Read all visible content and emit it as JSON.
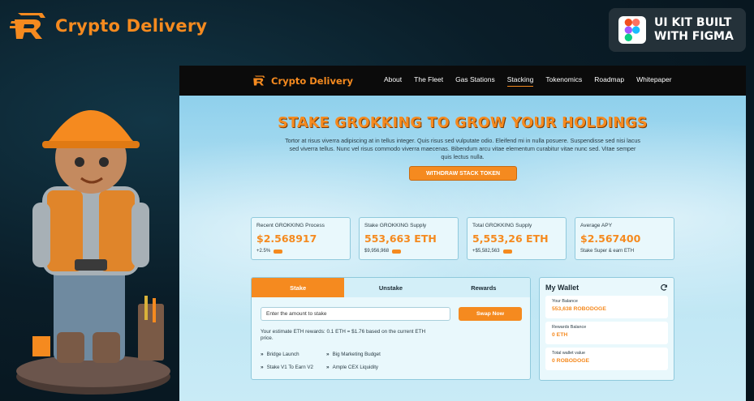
{
  "outer": {
    "brand_name": "Crypto Delivery",
    "badge_text_line1": "UI KIT BUILT",
    "badge_text_line2": "WITH FIGMA"
  },
  "nav": {
    "brand_name": "Crypto Delivery",
    "links": [
      "About",
      "The Fleet",
      "Gas Stations",
      "Stacking",
      "Tokenomics",
      "Roadmap",
      "Whitepaper"
    ],
    "active": "Stacking"
  },
  "hero": {
    "title": "STAKE GROKKING TO GROW YOUR HOLDINGS",
    "description": "Tortor at risus viverra adipiscing at in tellus integer. Quis risus sed vulputate odio. Eleifend mi in nulla posuere. Suspendisse sed nisi lacus sed viverra tellus. Nunc vel risus commodo viverra maecenas. Bibendum arcu vitae elementum curabitur vitae nunc sed. Vitae semper quis lectus nulla.",
    "button": "WITHDRAW STACK TOKEN"
  },
  "stats": [
    {
      "label": "Recent GROKKING Process",
      "value": "$2.568917",
      "sub": "+2.5%",
      "pill": true
    },
    {
      "label": "Stake GROKKING Supply",
      "value": "553,663 ETH",
      "sub": "$9,956,968",
      "pill": true
    },
    {
      "label": "Total GROKKING Supply",
      "value": "5,553,26 ETH",
      "sub": "+$5,582,563",
      "pill": true
    },
    {
      "label": "Average APY",
      "value": "$2.567400",
      "sub": "Stake Super & earn ETH",
      "pill": false
    }
  ],
  "stake": {
    "tabs": [
      "Stake",
      "Unstake",
      "Rewards"
    ],
    "active_tab": "Stake",
    "input_value": "Enter the amount to stake",
    "swap_button": "Swap Now",
    "note": "Your estimate ETH rewards: 0.1 ETH = $1.76 based on the current ETH price.",
    "features": [
      "Bridge Launch",
      "Big Marketing Budget",
      "Stake V1 To Earn V2",
      "Ample CEX Liquidity"
    ]
  },
  "wallet": {
    "title": "My Wallet",
    "rows": [
      {
        "label": "Your Balance",
        "value": "553,638 ROBODOGE"
      },
      {
        "label": "Rewards Balance",
        "value": "0 ETH"
      },
      {
        "label": "Total wallet value",
        "value": "0 ROBODOGE"
      }
    ]
  },
  "colors": {
    "accent": "#f58a1f",
    "dark": "#0b0b0b",
    "sky": "#bfe6f3"
  }
}
